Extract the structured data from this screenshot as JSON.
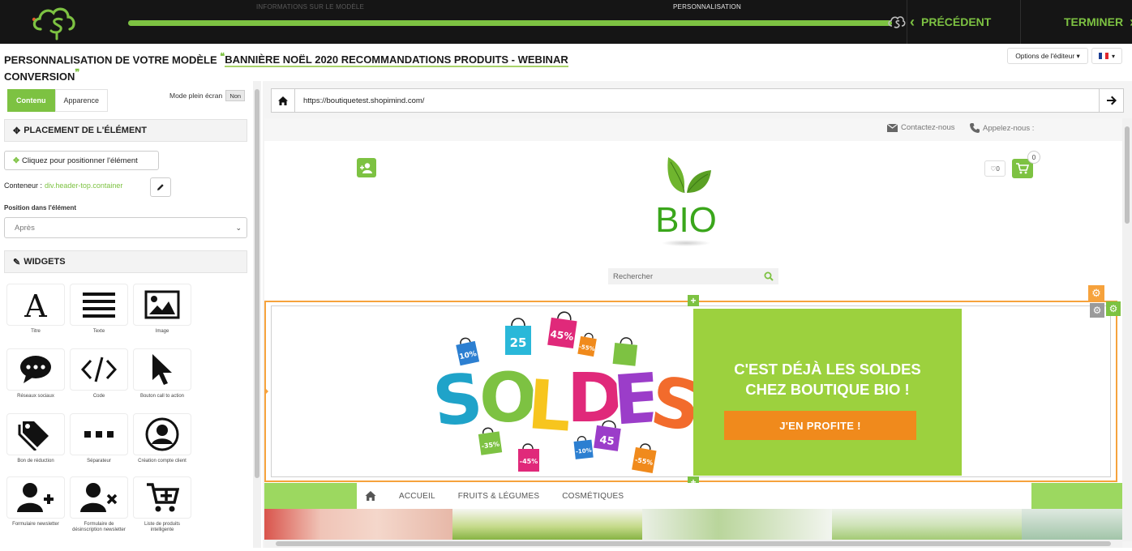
{
  "topbar": {
    "step1_label": "INFORMATIONS SUR LE MODÈLE",
    "step2_label": "PERSONNALISATION",
    "progress": 1.0,
    "prev_label": "PRÉCÉDENT",
    "finish_label": "TERMINER"
  },
  "header": {
    "title_prefix": "PERSONNALISATION DE VOTRE MODÈLE",
    "title_name": "BANNIÈRE NOËL 2020 RECOMMANDATIONS PRODUITS - WEBINAR",
    "title_name2": "CONVERSION",
    "editor_options": "Options de l'éditeur ▾",
    "language": "▾"
  },
  "sidebar": {
    "tab_content": "Contenu",
    "tab_appearance": "Apparence",
    "fullscreen_label": "Mode plein écran",
    "fullscreen_value": "Non",
    "placement_title": "PLACEMENT DE L'ÉLÉMENT",
    "place_button": "Cliquez pour positionner l'élément",
    "container_label": "Conteneur :",
    "container_value": "div.header-top.container",
    "position_label": "Position dans l'élément",
    "position_value": "Après",
    "widgets_title": "WIDGETS",
    "widgets": [
      {
        "label": "Titre",
        "icon": "title-icon"
      },
      {
        "label": "Texte",
        "icon": "text-icon"
      },
      {
        "label": "Image",
        "icon": "image-icon"
      },
      {
        "label": "Réseaux sociaux",
        "icon": "chat-bubble-icon"
      },
      {
        "label": "Code",
        "icon": "code-icon"
      },
      {
        "label": "Bouton call to action",
        "icon": "cursor-icon"
      },
      {
        "label": "Bon de réduction",
        "icon": "tags-icon"
      },
      {
        "label": "Séparateur",
        "icon": "dots-icon"
      },
      {
        "label": "Création compte client",
        "icon": "user-circle-icon"
      },
      {
        "label": "Formulaire newsletter",
        "icon": "user-plus-icon"
      },
      {
        "label": "Formulaire de désinscription newsletter",
        "icon": "user-remove-icon"
      },
      {
        "label": "Liste de produits intelligente",
        "icon": "cart-plus-icon"
      }
    ]
  },
  "preview": {
    "url": "https://boutiquetest.shopimind.com/",
    "contact_label": "Contactez-nous",
    "call_label": "Appelez-nous :",
    "logo_text": "BIO",
    "wishlist_count": "0",
    "cart_count": "0",
    "search_placeholder": "Rechercher",
    "banner": {
      "soldes_word": "SOLDES",
      "tags": [
        "10%",
        "25",
        "45%",
        "-55%",
        "-35%",
        "-45%",
        "-10%",
        "45",
        "-55%"
      ],
      "title_line1": "C'EST DÉJÀ LES SOLDES",
      "title_line2": "CHEZ BOUTIQUE BIO !",
      "cta": "J'EN PROFITE !"
    },
    "menu": [
      "ACCUEIL",
      "FRUITS & LÉGUMES",
      "COSMÉTIQUES"
    ]
  },
  "colors": {
    "brand_green": "#7dc242",
    "banner_green": "#9cd13e",
    "cta_orange": "#f08a1c",
    "selection_orange": "#f6a23c"
  }
}
